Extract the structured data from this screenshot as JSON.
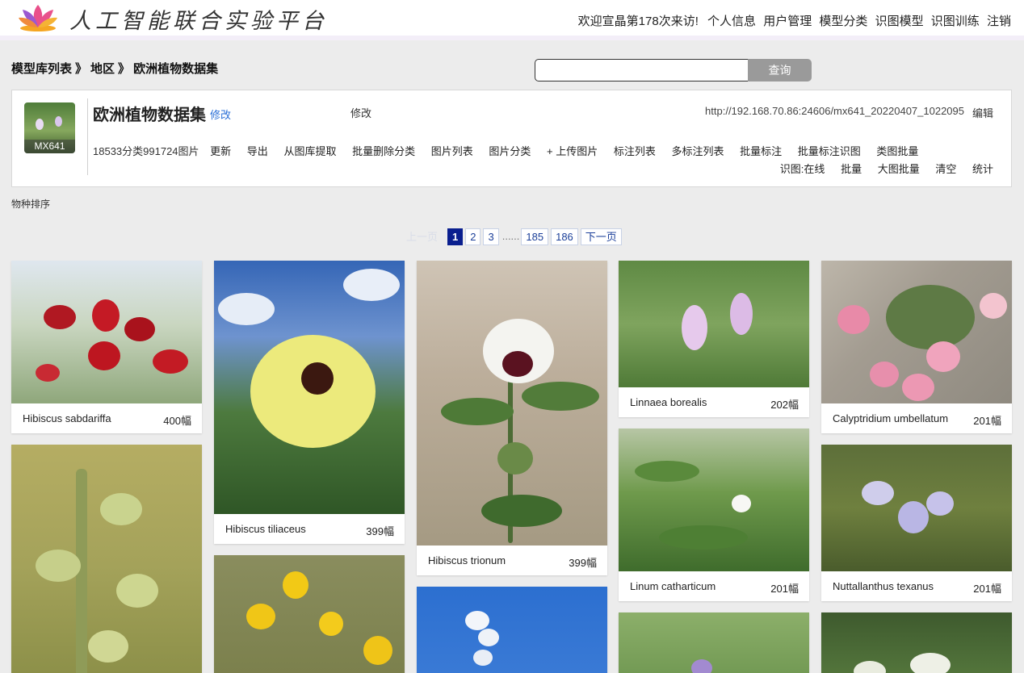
{
  "header": {
    "brand": "人工智能联合实验平台",
    "welcome": "欢迎宣晶第178次来访!",
    "nav": [
      "个人信息",
      "用户管理",
      "模型分类",
      "识图模型",
      "识图训练",
      "注销"
    ]
  },
  "breadcrumb": [
    "模型库列表",
    "地区",
    "欧洲植物数据集"
  ],
  "breadcrumb_sep": "》",
  "search": {
    "value": "",
    "placeholder": "",
    "button": "查询"
  },
  "dataset": {
    "thumb_tag": "MX641",
    "title": "欧洲植物数据集",
    "edit_link": "修改",
    "edit_plain": "修改",
    "url": "http://192.168.70.86:24606/mx641_20220407_1022095",
    "edit_right": "编辑",
    "counts": "18533分类991724图片",
    "actions": [
      "更新",
      "导出",
      "从图库提取",
      "批量删除分类",
      "图片列表",
      "图片分类",
      "+ 上传图片",
      "标注列表",
      "多标注列表",
      "批量标注",
      "批量标注识图",
      "类图批量"
    ],
    "recog_label": "识图:",
    "recog_actions": [
      "在线",
      "批量",
      "大图批量",
      "清空",
      "统计"
    ]
  },
  "sort_label": "物种排序",
  "pagination": {
    "prev": "上一页",
    "pages": [
      "1",
      "2",
      "3"
    ],
    "dots": "......",
    "last_pages": [
      "185",
      "186"
    ],
    "next": "下一页",
    "current": "1"
  },
  "gallery": [
    {
      "name": "Hibiscus sabdariffa",
      "count": "400幅"
    },
    {
      "name": "Hibiscus tiliaceus",
      "count": "399幅"
    },
    {
      "name": "Hibiscus trionum",
      "count": "399幅"
    },
    {
      "name": "Linnaea borealis",
      "count": "202幅"
    },
    {
      "name": "Calyptridium umbellatum",
      "count": "201幅"
    },
    {
      "name": "Linum catharticum",
      "count": "201幅"
    },
    {
      "name": "Nuttallanthus texanus",
      "count": "201幅"
    }
  ],
  "colors": {
    "active_page": "#0a1f8f",
    "link_blue": "#2a6fd6",
    "search_button": "#9a9a9a"
  }
}
